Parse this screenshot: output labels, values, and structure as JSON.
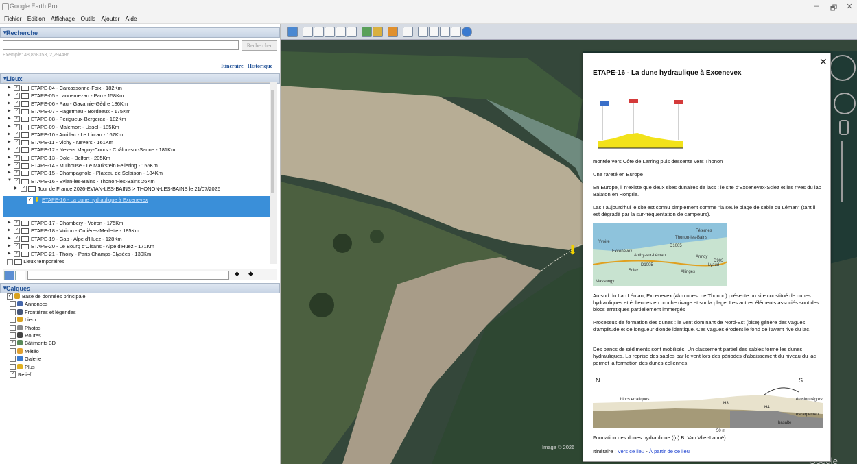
{
  "window": {
    "title": "Google Earth Pro",
    "minimize": "–",
    "maximize": "🗗",
    "close": "✕"
  },
  "menu": [
    "Fichier",
    "Édition",
    "Affichage",
    "Outils",
    "Ajouter",
    "Aide"
  ],
  "search": {
    "header": "Recherche",
    "button": "Rechercher",
    "hint": "Exemple: 48,858353, 2,294486",
    "link_itinerary": "Itinéraire",
    "link_history": "Historique"
  },
  "places": {
    "header": "Lieux",
    "items": [
      {
        "label": "ETAPE-04 - Carcassonne-Foix - 182Km"
      },
      {
        "label": "ETAPE-05 - Lannemezan - Pau - 158Km"
      },
      {
        "label": "ETAPE-06 - Pau - Gavarnie-Gèdre 186Km"
      },
      {
        "label": "ETAPE-07 - Hagetmau - Bordeaux - 175Km"
      },
      {
        "label": "ETAPE-08 - Périgueux-Bergerac - 182Km"
      },
      {
        "label": "ETAPE-09 - Malemort - Ussel - 185Km"
      },
      {
        "label": "ETAPE-10 - Aurillac - Le Lioran - 167Km"
      },
      {
        "label": "ETAPE-11 - Vichy - Nevers - 161Km"
      },
      {
        "label": "ETAPE-12 - Nevers Magny-Cours - Châlon-sur-Saone - 181Km"
      },
      {
        "label": "ETAPE-13 - Dole - Belfort - 205Km"
      },
      {
        "label": "ETAPE-14 - Mulhouse - Le Markstein Fellering - 155Km"
      },
      {
        "label": "ETAPE-15 - Champagnole - Plateau de Solaison - 184Km"
      },
      {
        "label": "ETAPE-16 - Evian-les-Bains - Thonon-les-Bains 26Km"
      }
    ],
    "subitem": "Tour de France 2026-EVIAN-LES-BAINS > THONON-LES-BAINS le 21/07/2026",
    "selected": "ETAPE-16 - La dune hydraulique à Excenevex",
    "items_after": [
      {
        "label": "ETAPE-17 - Chambery - Voiron - 175Km"
      },
      {
        "label": "ETAPE-18 - Voiron - Orcières-Merlette - 185Km"
      },
      {
        "label": "ETAPE-19 - Gap - Alpe d'Huez - 128Km"
      },
      {
        "label": "ETAPE-20 - Le Bourg d'Oisans - Alpe d'Huez - 171Km"
      },
      {
        "label": "ETAPE-21 - Thoiry - Paris Champs-Elysées - 130Km"
      }
    ],
    "temporary": "Lieux temporaires"
  },
  "layers": {
    "header": "Calques",
    "items": [
      {
        "label": "Base de données principale",
        "color": "#d9a21f"
      },
      {
        "label": "Annonces",
        "color": "#4466aa"
      },
      {
        "label": "Frontières et légendes",
        "color": "#445577"
      },
      {
        "label": "Lieux",
        "color": "#d9a21f"
      },
      {
        "label": "Photos",
        "color": "#888888"
      },
      {
        "label": "Routes",
        "color": "#444444"
      },
      {
        "label": "Bâtiments 3D",
        "color": "#5a8a5a"
      },
      {
        "label": "Météo",
        "color": "#e0a030"
      },
      {
        "label": "Galerie",
        "color": "#3a7ad0"
      },
      {
        "label": "Plus",
        "color": "#e0b020"
      },
      {
        "label": "Relief",
        "color": ""
      }
    ]
  },
  "popup": {
    "title": "ETAPE-16 - La dune hydraulique à Excenevex",
    "profile_caption": "montée vers Côte de Larring puis descente vers Thonon",
    "p1": "Une rareté en Europe",
    "p2": "En Europe, il n'existe que deux sites dunaires de lacs : le site d'Excenevex-Sciez et les rives du lac Balaton en Hongrie.",
    "p3": "Las ! aujourd'hui le site est connu simplement comme \"la seule plage de sable du Léman\" (tant il est dégradé par la sur-fréquentation de campeurs).",
    "map_labels": [
      "Yvoire",
      "Excenevex",
      "Anthy-sur-Léman",
      "Thonon-les-Bains",
      "Sciez",
      "Allinges",
      "Armoy",
      "Lyaud",
      "Massongy",
      "D1005",
      "D1005",
      "D903",
      "Féternes"
    ],
    "p4": "Au sud du Lac Léman, Excenevex (4km ouest de Thonon) présente un site constitué de dunes hydrauliques et éoliennes en proche rivage et sur la plage. Les autres éléments associés sont des blocs erratiques partiellement immergés",
    "p5": "Processus de formation des dunes : le vent dominant de Nord-Est (bise) génère des vagues d'amplitude et de longueur d'onde identique. Ces vagues érodent le fond de l'avant rive du lac.",
    "p6": "Des bancs de sédiments sont mobilisés. Un classement partiel des sables forme les dunes hydrauliques. La reprise des sables par le vent lors des périodes d'abaissement du niveau du lac permet la formation des dunes éoliennes.",
    "diagram_labels": [
      "N",
      "S",
      "blocs erratiques",
      "H3",
      "H4",
      "basalte",
      "érosion régression",
      "escarpement",
      "50 m"
    ],
    "figure_caption": "Formation des dunes hydraulique ((c) B. Van Vliet-Lanoë)",
    "itinerary_prefix": "Itinéraire : ",
    "itinerary_to": "Vers ce lieu",
    "itinerary_sep": " - ",
    "itinerary_from": "À partir de ce lieu",
    "close": "✕"
  },
  "map": {
    "image_credit": "Image © 2026",
    "brand": "Google Earth"
  }
}
